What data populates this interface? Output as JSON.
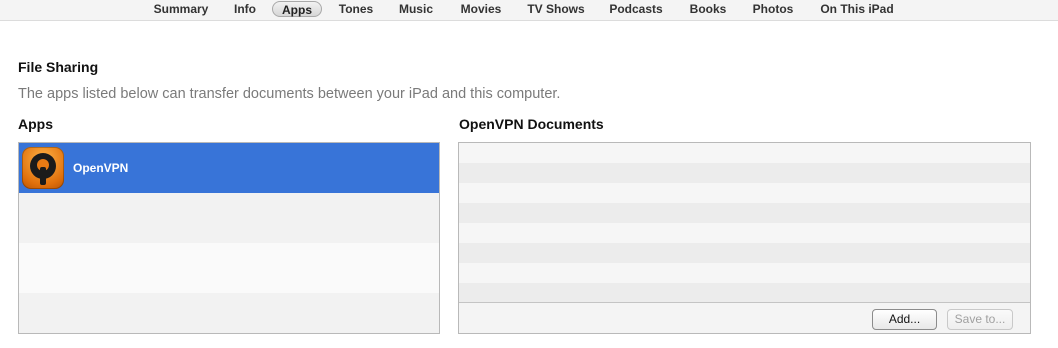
{
  "tabs": [
    {
      "label": "Summary",
      "selected": false
    },
    {
      "label": "Info",
      "selected": false
    },
    {
      "label": "Apps",
      "selected": true
    },
    {
      "label": "Tones",
      "selected": false
    },
    {
      "label": "Music",
      "selected": false
    },
    {
      "label": "Movies",
      "selected": false
    },
    {
      "label": "TV Shows",
      "selected": false
    },
    {
      "label": "Podcasts",
      "selected": false
    },
    {
      "label": "Books",
      "selected": false
    },
    {
      "label": "Photos",
      "selected": false
    },
    {
      "label": "On This iPad",
      "selected": false
    }
  ],
  "file_sharing": {
    "title": "File Sharing",
    "description": "The apps listed below can transfer documents between your iPad and this computer."
  },
  "apps_panel": {
    "header": "Apps",
    "items": [
      {
        "name": "OpenVPN",
        "icon": "openvpn-app-icon",
        "selected": true
      }
    ]
  },
  "documents_panel": {
    "header": "OpenVPN Documents",
    "add_label": "Add...",
    "save_label": "Save to..."
  },
  "colors": {
    "selection": "#3874d8",
    "app_icon_orange": "#e87a14"
  }
}
